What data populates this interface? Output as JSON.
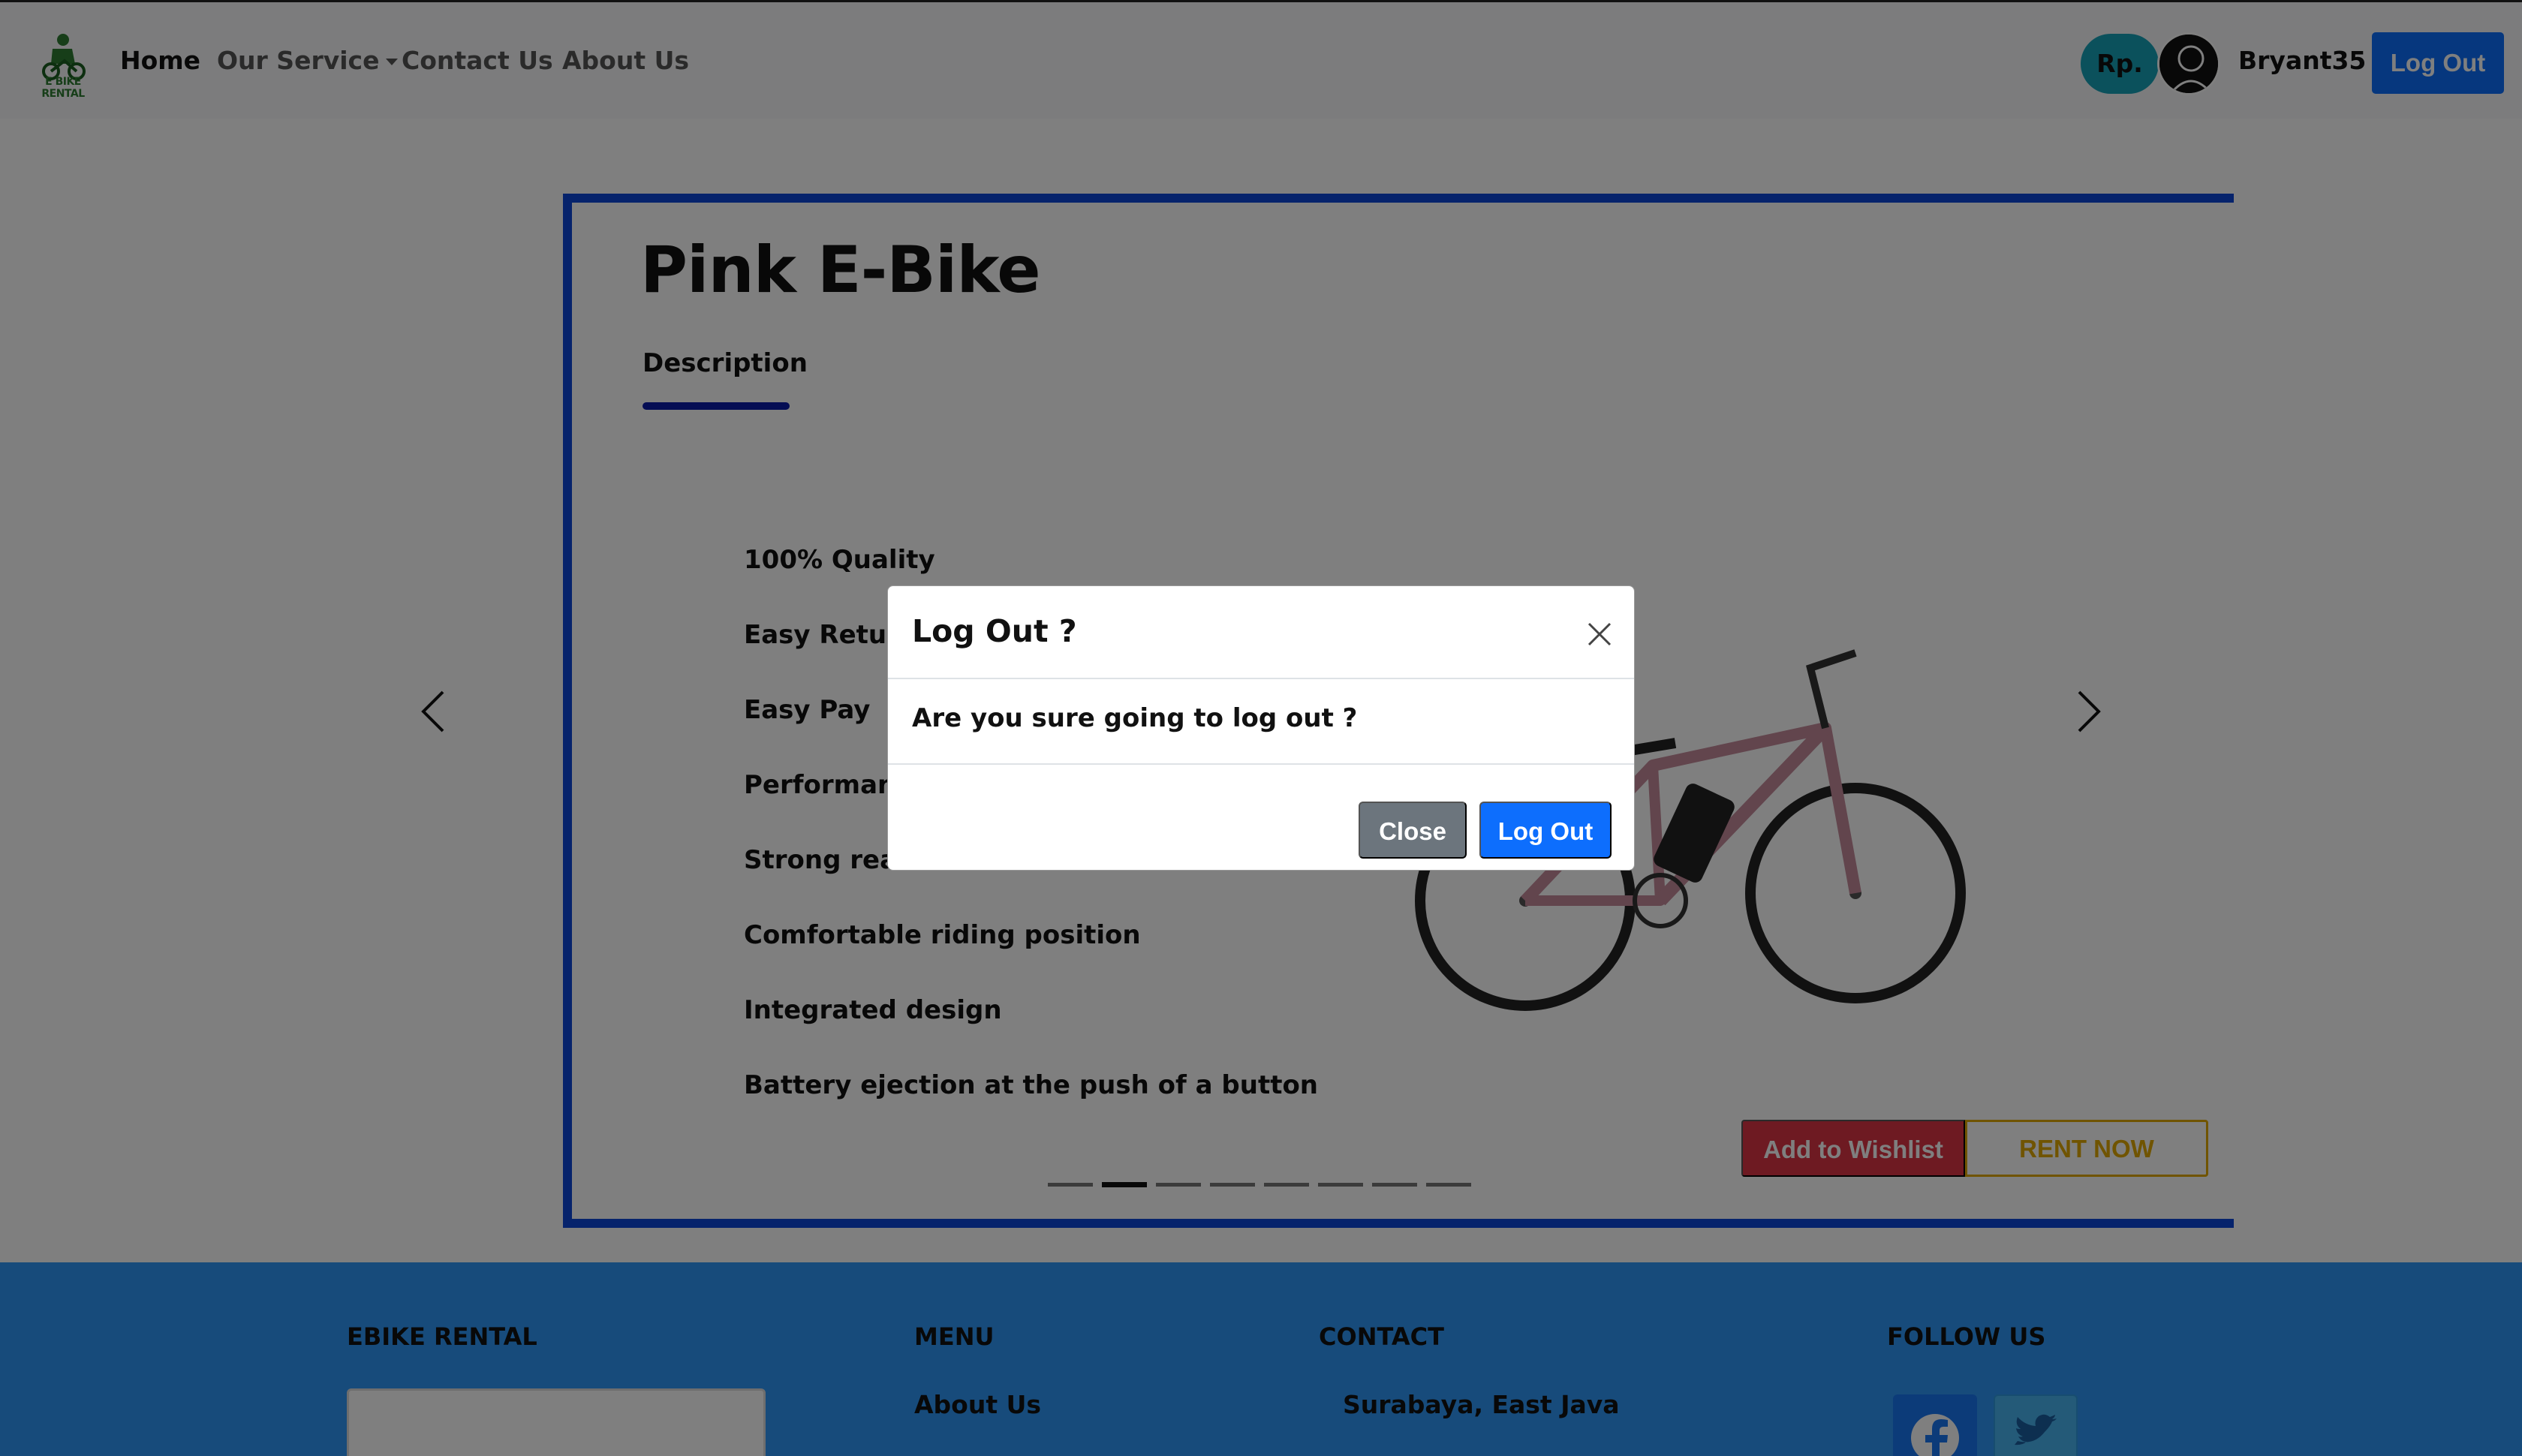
{
  "navbar": {
    "logo_text": "E BIKE RENTAL",
    "links": [
      {
        "label": "Home",
        "active": true
      },
      {
        "label": "Our Service",
        "dropdown": true
      },
      {
        "label": "Contact Us"
      },
      {
        "label": "About Us"
      }
    ],
    "currency_badge": "Rp.",
    "username": "Bryant35",
    "logout_label": "Log Out"
  },
  "product": {
    "title": "Pink E-Bike",
    "tab_label": "Description",
    "features": [
      "100% Quality",
      "Easy Return",
      "Easy Pay",
      "Performance",
      "Strong rear-wheel hub motor",
      "Comfortable riding position",
      "Integrated design",
      "Battery ejection at the push of a button"
    ],
    "carousel": {
      "slide_count": 8,
      "active_index": 1
    },
    "wishlist_label": "Add to Wishlist",
    "rent_label": "RENT NOW"
  },
  "footer": {
    "headings": {
      "brand": "EBIKE RENTAL",
      "menu": "MENU",
      "contact": "CONTACT",
      "follow": "FOLLOW US"
    },
    "menu_first_link": "About Us",
    "contact_address": "Surabaya, East Java"
  },
  "modal": {
    "title": "Log Out ?",
    "body": "Are you sure going to log out ?",
    "close_label": "Close",
    "confirm_label": "Log Out"
  },
  "colors": {
    "primary": "#0d6efd",
    "danger": "#dc3545",
    "warning": "#e0a800",
    "info": "#17a2b8",
    "secondary": "#6c757d",
    "card_border": "#0d47d9",
    "footer_bg": "#2e97f7"
  },
  "icons": {
    "prev": "chevron-left-icon",
    "next": "chevron-right-icon",
    "close": "close-icon",
    "avatar": "user-avatar-icon",
    "facebook": "facebook-icon",
    "twitter": "twitter-icon"
  }
}
